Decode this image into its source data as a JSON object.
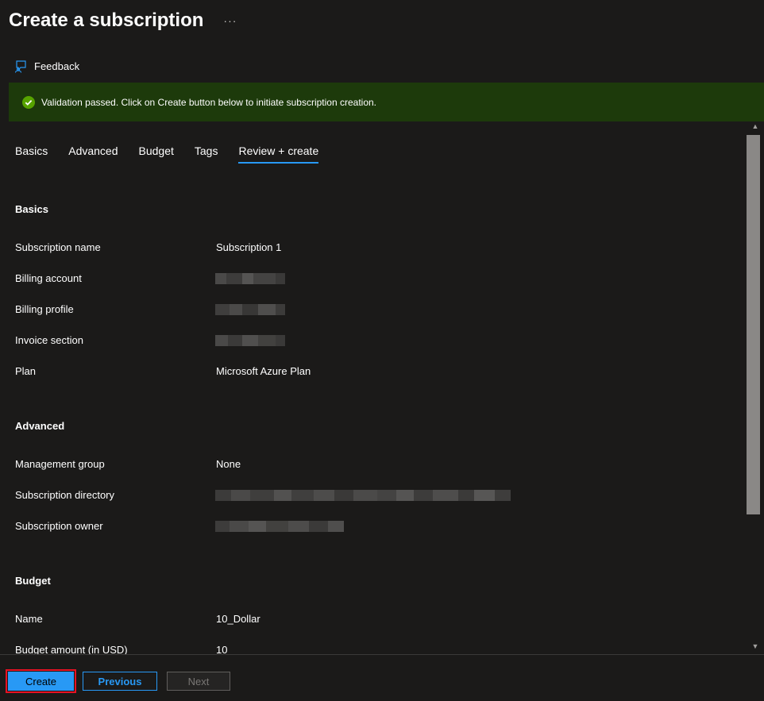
{
  "header": {
    "title": "Create a subscription",
    "more_label": "···"
  },
  "toolbar": {
    "feedback_label": "Feedback"
  },
  "banner": {
    "message": "Validation passed. Click on Create button below to initiate subscription creation.",
    "color": "#1d3a0b"
  },
  "tabs": [
    {
      "label": "Basics"
    },
    {
      "label": "Advanced"
    },
    {
      "label": "Budget"
    },
    {
      "label": "Tags"
    },
    {
      "label": "Review + create",
      "active": true
    }
  ],
  "sections": {
    "basics": {
      "title": "Basics",
      "rows": [
        {
          "label": "Subscription name",
          "value": "Subscription 1"
        },
        {
          "label": "Billing account",
          "value": ""
        },
        {
          "label": "Billing profile",
          "value": ""
        },
        {
          "label": "Invoice section",
          "value": ""
        },
        {
          "label": "Plan",
          "value": "Microsoft Azure Plan"
        }
      ]
    },
    "advanced": {
      "title": "Advanced",
      "rows": [
        {
          "label": "Management group",
          "value": "None"
        },
        {
          "label": "Subscription directory",
          "value": ""
        },
        {
          "label": "Subscription owner",
          "value": ""
        }
      ]
    },
    "budget": {
      "title": "Budget",
      "rows": [
        {
          "label": "Name",
          "value": "10_Dollar"
        },
        {
          "label": "Budget amount (in USD)",
          "value": "10"
        }
      ]
    }
  },
  "footer": {
    "create_label": "Create",
    "previous_label": "Previous",
    "next_label": "Next"
  },
  "colors": {
    "accent": "#2899f5",
    "background": "#1b1a19",
    "success": "#57a300",
    "highlight_outline": "#e81123"
  }
}
